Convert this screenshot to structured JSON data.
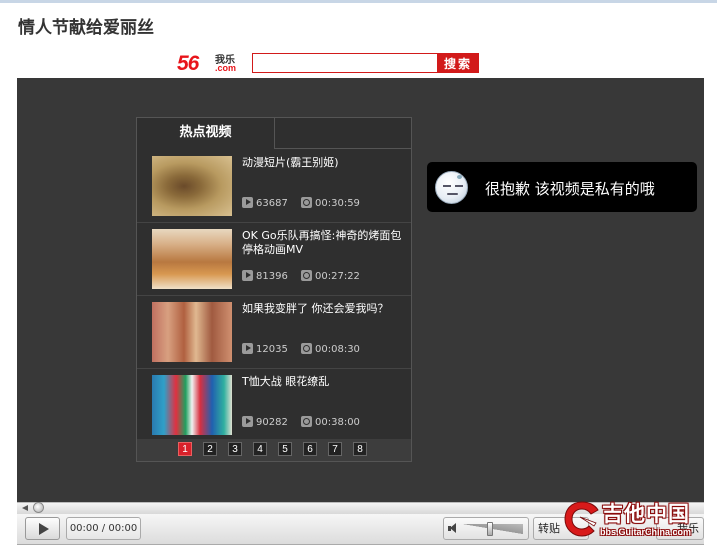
{
  "page": {
    "title": "情人节献给爱丽丝"
  },
  "site": {
    "logo_number": "56",
    "logo_cn": "我乐",
    "logo_domain": ".com"
  },
  "search": {
    "value": "",
    "placeholder": "",
    "button_label": "搜索"
  },
  "hot_panel": {
    "tab_label": "热点视频",
    "videos": [
      {
        "title": "动漫短片(霸王别姬)",
        "views": "63687",
        "duration": "00:30:59"
      },
      {
        "title": "OK Go乐队再搞怪:神奇的烤面包停格动画MV",
        "views": "81396",
        "duration": "00:27:22"
      },
      {
        "title": "如果我变胖了 你还会爱我吗？",
        "views": "12035",
        "duration": "00:08:30"
      },
      {
        "title": "T恤大战 眼花缭乱",
        "views": "90282",
        "duration": "00:38:00"
      }
    ],
    "pages": [
      "1",
      "2",
      "3",
      "4",
      "5",
      "6",
      "7",
      "8"
    ],
    "active_page": "1"
  },
  "player": {
    "private_message": "很抱歉 该视频是私有的哦",
    "time_display": "00:00 / 00:00",
    "share_label": "转贴",
    "right_label": "我乐",
    "volume_level": 0.45,
    "progress": 0
  },
  "watermark": {
    "name": "吉他中国",
    "url": "bbs.GuitarChina.com"
  },
  "colors": {
    "brand_red": "#d21a1a",
    "player_bg": "#383838",
    "panel_bg": "#2f2f2f",
    "active_page": "#d8202a"
  }
}
